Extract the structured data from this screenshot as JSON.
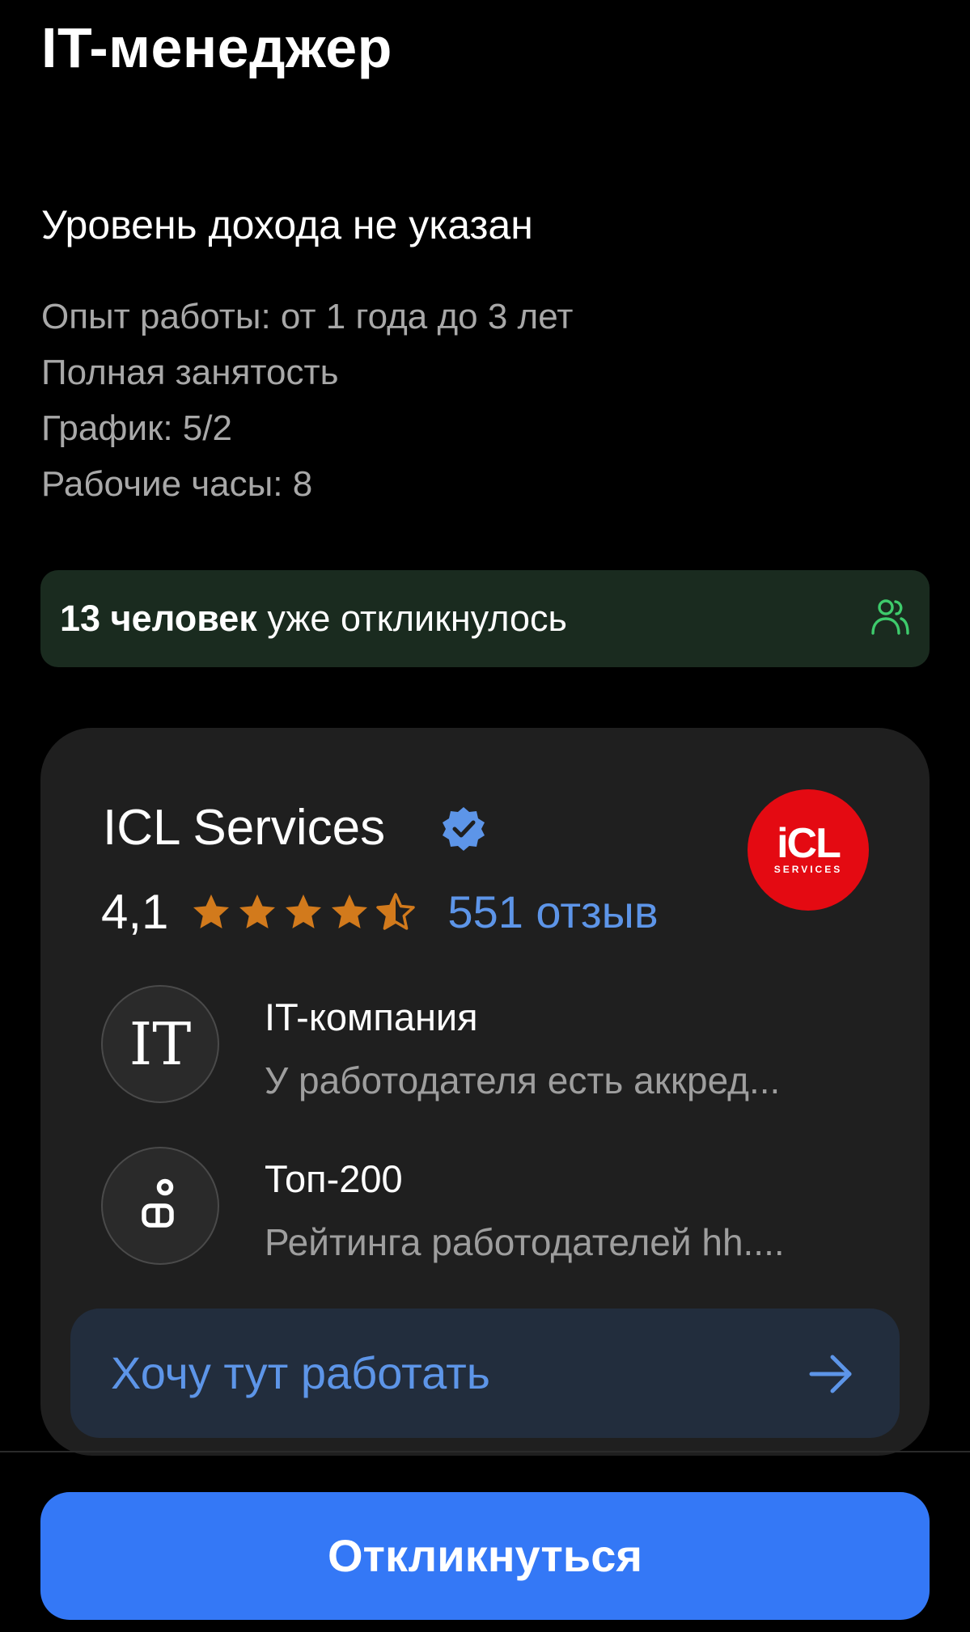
{
  "vacancy": {
    "title": "IT-менеджер",
    "salary": "Уровень дохода не указан",
    "details": [
      "Опыт работы: от 1 года до 3 лет",
      "Полная занятость",
      "График: 5/2",
      "Рабочие часы: 8"
    ]
  },
  "responses": {
    "count_text": "13 человек",
    "rest_text": " уже откликнулось",
    "icon": "people-icon",
    "accent_color": "#3ecb6c"
  },
  "company": {
    "name": "ICL Services",
    "verified_icon": "verified-badge-icon",
    "logo": {
      "main": "iCL",
      "sub": "SERVICES",
      "color": "#e40a12"
    },
    "rating": "4,1",
    "rating_stars": 4.5,
    "star_color": "#d27a1c",
    "reviews": "551 отзыв",
    "badges": [
      {
        "icon": "it-company-icon",
        "icon_text": "IT",
        "title": "IT-компания",
        "description": "У работодателя есть аккред..."
      },
      {
        "icon": "top-200-icon",
        "title": "Топ-200",
        "description": "Рейтинга работодателей hh...."
      }
    ],
    "want_to_work": "Хочу тут работать",
    "link_color": "#5d95e8"
  },
  "actions": {
    "respond": "Откликнуться",
    "primary_color": "#3478f6"
  }
}
